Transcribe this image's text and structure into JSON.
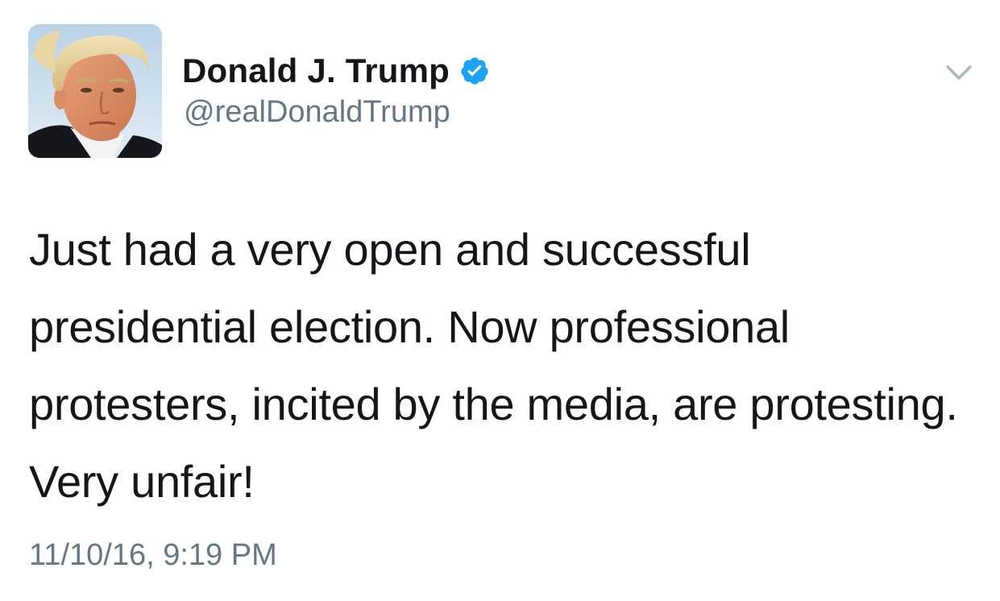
{
  "author": {
    "display_name": "Donald J. Trump",
    "handle": "@realDonaldTrump",
    "verified": true,
    "avatar_icon": "profile-photo",
    "verified_icon": "verified-badge-icon",
    "verified_color": "#1da1f2"
  },
  "tweet": {
    "text": "Just had a very open and successful presidential election. Now professional protesters, incited by the media, are protesting. Very unfair!",
    "timestamp": "11/10/16, 9:19 PM"
  },
  "menu": {
    "icon": "chevron-down-icon"
  },
  "colors": {
    "text_primary": "#14171a",
    "text_secondary": "#657786",
    "chevron": "#aab8c2",
    "background": "#ffffff"
  }
}
